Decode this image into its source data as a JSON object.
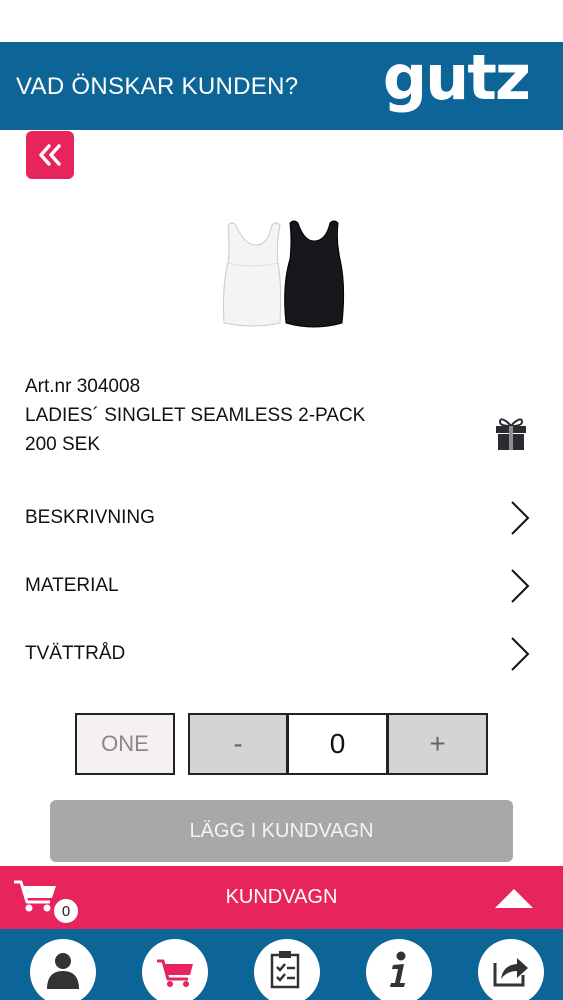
{
  "header": {
    "title": "VAD ÖNSKAR KUNDEN?",
    "logo": "gutz"
  },
  "back_button": {
    "icon": "double-chevron-left-icon"
  },
  "product": {
    "image_icon": "singlet-pack-image",
    "art_nr": "Art.nr 304008",
    "name": "LADIES´ SINGLET SEAMLESS 2-PACK",
    "price": "200 SEK",
    "gift_icon": "gift-icon"
  },
  "accordion": [
    {
      "label": "BESKRIVNING",
      "icon": "chevron-right-icon"
    },
    {
      "label": "MATERIAL",
      "icon": "chevron-right-icon"
    },
    {
      "label": "TVÄTTRÅD",
      "icon": "chevron-right-icon"
    }
  ],
  "purchase": {
    "size": "ONE",
    "minus": "-",
    "quantity": "0",
    "plus": "+",
    "add_to_cart": "LÄGG I KUNDVAGN"
  },
  "cartbar": {
    "label": "KUNDVAGN",
    "count": "0",
    "icon": "cart-icon",
    "expand_icon": "triangle-up-icon"
  },
  "bottom_nav": [
    {
      "name": "profile",
      "icon": "person-icon"
    },
    {
      "name": "cart",
      "icon": "cart-icon"
    },
    {
      "name": "checklist",
      "icon": "checklist-icon"
    },
    {
      "name": "info",
      "icon": "info-icon"
    },
    {
      "name": "share",
      "icon": "share-icon"
    }
  ],
  "colors": {
    "brand_blue": "#0d6496",
    "accent_pink": "#e8245c",
    "disabled_gray": "#a8a8aa"
  }
}
